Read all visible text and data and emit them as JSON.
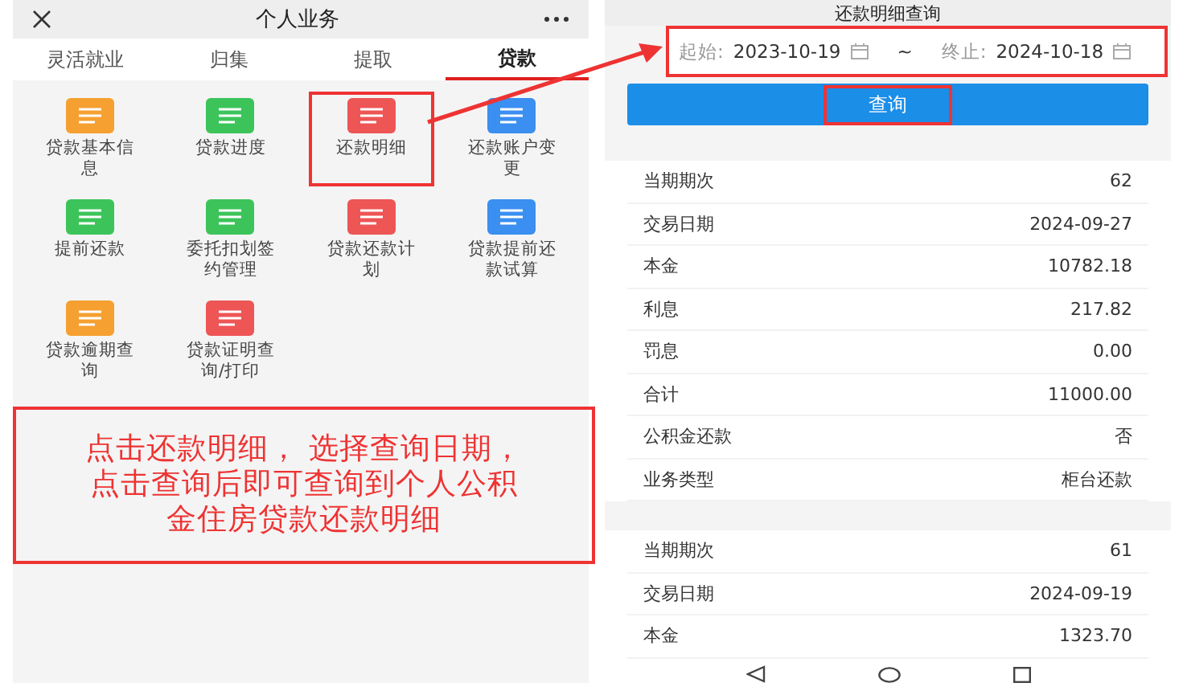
{
  "left": {
    "title": "个人业务",
    "tabs": [
      {
        "label": "灵活就业",
        "selected": false
      },
      {
        "label": "归集",
        "selected": false
      },
      {
        "label": "提取",
        "selected": false
      },
      {
        "label": "贷款",
        "selected": true
      }
    ],
    "services": [
      {
        "label": "贷款基本信息",
        "color": "#f5a030",
        "highlighted": false
      },
      {
        "label": "贷款进度",
        "color": "#3cc45a",
        "highlighted": false
      },
      {
        "label": "还款明细",
        "color": "#ee5555",
        "highlighted": true
      },
      {
        "label": "还款账户变更",
        "color": "#3a8ff0",
        "highlighted": false
      },
      {
        "label": "提前还款",
        "color": "#3cc45a",
        "highlighted": false
      },
      {
        "label": "委托扣划签约管理",
        "color": "#3cc45a",
        "highlighted": false
      },
      {
        "label": "贷款还款计划",
        "color": "#ee5555",
        "highlighted": false
      },
      {
        "label": "贷款提前还款试算",
        "color": "#3a8ff0",
        "highlighted": false
      },
      {
        "label": "贷款逾期查询",
        "color": "#f5a030",
        "highlighted": false
      },
      {
        "label": "贷款证明查询/打印",
        "color": "#ee5555",
        "highlighted": false
      }
    ],
    "annotation_lines": [
      "点击还款明细， 选择查询日期，",
      "点击查询后即可查询到个人公积",
      "金住房贷款还款明细"
    ]
  },
  "right": {
    "title": "还款明细查询",
    "date_range": {
      "start_label": "起始:",
      "start_date": "2023-10-19",
      "separator": "~",
      "end_label": "终止:",
      "end_date": "2024-10-18",
      "highlighted": true
    },
    "query_button": {
      "label": "查询",
      "highlighted": true
    },
    "records": [
      {
        "fields": [
          {
            "label": "当期期次",
            "value": "62"
          },
          {
            "label": "交易日期",
            "value": "2024-09-27"
          },
          {
            "label": "本金",
            "value": "10782.18"
          },
          {
            "label": "利息",
            "value": "217.82"
          },
          {
            "label": "罚息",
            "value": "0.00"
          },
          {
            "label": "合计",
            "value": "11000.00"
          },
          {
            "label": "公积金还款",
            "value": "否"
          },
          {
            "label": "业务类型",
            "value": "柜台还款"
          }
        ]
      },
      {
        "fields": [
          {
            "label": "当期期次",
            "value": "61"
          },
          {
            "label": "交易日期",
            "value": "2024-09-19"
          },
          {
            "label": "本金",
            "value": "1323.70"
          }
        ]
      }
    ]
  }
}
